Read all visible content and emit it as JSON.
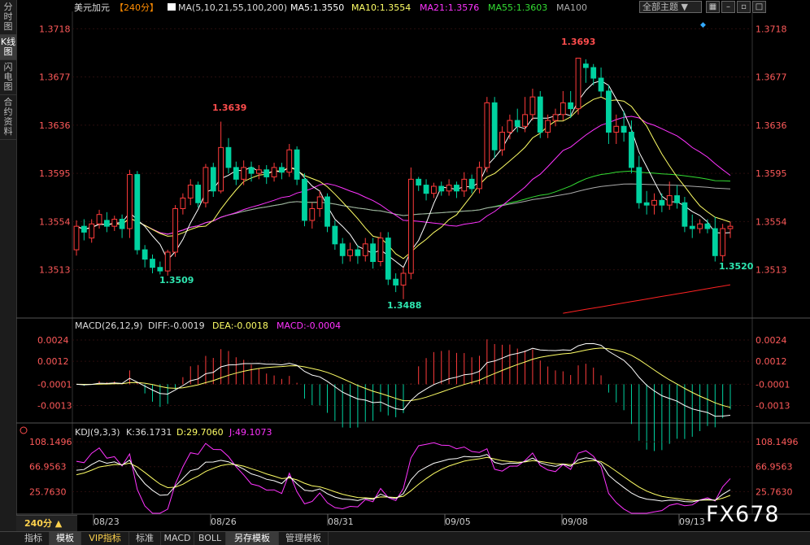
{
  "sidebar": [
    {
      "label": "分时图",
      "active": false
    },
    {
      "label": "K线图",
      "active": true
    },
    {
      "label": "闪电图",
      "active": false
    },
    {
      "label": "合约资料",
      "active": false
    }
  ],
  "header": {
    "symbol": "美元加元",
    "period_tag": "【240分】",
    "ma_params": "MA(5,10,21,55,100,200)",
    "ma5": "MA5:1.3550",
    "ma10": "MA10:1.3554",
    "ma21": "MA21:1.3576",
    "ma55": "MA55:1.3603",
    "ma100": "MA100",
    "theme_button": "全部主题"
  },
  "colors": {
    "up": "#ff3b3b",
    "down": "#00d2a0",
    "ma5": "#ffffff",
    "ma10": "#ffff66",
    "ma21": "#ff33ff",
    "ma55": "#33dd33",
    "ma100": "#aaaaaa",
    "ma200": "#ff2222"
  },
  "price_axis": [
    "1.3718",
    "1.3677",
    "1.3636",
    "1.3595",
    "1.3554",
    "1.3513"
  ],
  "annotations": {
    "high1": "1.3639",
    "high2": "1.3693",
    "low1": "1.3509",
    "low2": "1.3488",
    "low3": "1.3520"
  },
  "macd": {
    "title": "MACD(26,12,9)",
    "diff": "DIFF:-0.0019",
    "dea": "DEA:-0.0018",
    "macd": "MACD:-0.0004",
    "axis": [
      "0.0024",
      "0.0012",
      "-0.0001",
      "-0.0013"
    ]
  },
  "kdj": {
    "title": "KDJ(9,3,3)",
    "k": "K:36.1731",
    "d": "D:29.7060",
    "j": "J:49.1073",
    "axis": [
      "108.1496",
      "66.9563",
      "25.7630"
    ]
  },
  "dates": [
    "08/23",
    "08/26",
    "08/31",
    "09/05",
    "09/08",
    "09/13"
  ],
  "period_button": "240分 ▲",
  "watermark": "FX678",
  "bottom_tabs": [
    "指标",
    "模板",
    "VIP指标",
    "标准",
    "MACD",
    "BOLL",
    "另存模板",
    "管理模板"
  ],
  "chart_data": {
    "type": "candlestick",
    "title": "美元加元 240分",
    "y_range": [
      1.3474,
      1.373
    ],
    "candles": [
      [
        1.353,
        1.355,
        1.3525,
        1.3555
      ],
      [
        1.355,
        1.3545,
        1.3538,
        1.3556
      ],
      [
        1.354,
        1.3552,
        1.3536,
        1.3556
      ],
      [
        1.3552,
        1.356,
        1.3548,
        1.3564
      ],
      [
        1.3555,
        1.355,
        1.3545,
        1.3562
      ],
      [
        1.355,
        1.3556,
        1.3546,
        1.3559
      ],
      [
        1.3556,
        1.3548,
        1.354,
        1.356
      ],
      [
        1.3548,
        1.3594,
        1.354,
        1.3598
      ],
      [
        1.3594,
        1.353,
        1.3526,
        1.3597
      ],
      [
        1.353,
        1.3522,
        1.3515,
        1.3534
      ],
      [
        1.3522,
        1.3515,
        1.351,
        1.3526
      ],
      [
        1.3515,
        1.3512,
        1.3509,
        1.352
      ],
      [
        1.3512,
        1.3528,
        1.3508,
        1.353
      ],
      [
        1.3528,
        1.3565,
        1.3524,
        1.3568
      ],
      [
        1.3565,
        1.3574,
        1.356,
        1.3578
      ],
      [
        1.3574,
        1.3585,
        1.3568,
        1.359
      ],
      [
        1.3585,
        1.357,
        1.3566,
        1.3588
      ],
      [
        1.357,
        1.36,
        1.3566,
        1.3603
      ],
      [
        1.36,
        1.358,
        1.3575,
        1.3604
      ],
      [
        1.358,
        1.3617,
        1.3578,
        1.3639
      ],
      [
        1.3617,
        1.36,
        1.3595,
        1.3625
      ],
      [
        1.36,
        1.359,
        1.3585,
        1.3605
      ],
      [
        1.359,
        1.36,
        1.3585,
        1.3606
      ],
      [
        1.36,
        1.3595,
        1.3588,
        1.3605
      ],
      [
        1.3595,
        1.3598,
        1.359,
        1.3602
      ],
      [
        1.3598,
        1.3592,
        1.3586,
        1.3602
      ],
      [
        1.3592,
        1.36,
        1.3588,
        1.3604
      ],
      [
        1.36,
        1.3596,
        1.359,
        1.3604
      ],
      [
        1.3596,
        1.3615,
        1.3592,
        1.362
      ],
      [
        1.3615,
        1.359,
        1.3585,
        1.3618
      ],
      [
        1.359,
        1.3555,
        1.355,
        1.3595
      ],
      [
        1.3555,
        1.3565,
        1.3548,
        1.357
      ],
      [
        1.3565,
        1.3575,
        1.3558,
        1.358
      ],
      [
        1.3575,
        1.355,
        1.3545,
        1.3578
      ],
      [
        1.355,
        1.3535,
        1.353,
        1.3555
      ],
      [
        1.3535,
        1.3525,
        1.3518,
        1.354
      ],
      [
        1.3525,
        1.353,
        1.352,
        1.3536
      ],
      [
        1.353,
        1.3525,
        1.3518,
        1.3534
      ],
      [
        1.3525,
        1.3535,
        1.352,
        1.354
      ],
      [
        1.3535,
        1.352,
        1.3514,
        1.354
      ],
      [
        1.352,
        1.354,
        1.3516,
        1.3545
      ],
      [
        1.354,
        1.3505,
        1.35,
        1.3545
      ],
      [
        1.3505,
        1.35,
        1.3494,
        1.351
      ],
      [
        1.35,
        1.351,
        1.3488,
        1.3515
      ],
      [
        1.351,
        1.359,
        1.3505,
        1.36
      ],
      [
        1.359,
        1.3585,
        1.358,
        1.3592
      ],
      [
        1.3585,
        1.3578,
        1.3572,
        1.359
      ],
      [
        1.3578,
        1.3584,
        1.3574,
        1.3587
      ],
      [
        1.3584,
        1.358,
        1.3576,
        1.3588
      ],
      [
        1.358,
        1.3585,
        1.3576,
        1.359
      ],
      [
        1.3585,
        1.358,
        1.3574,
        1.3588
      ],
      [
        1.358,
        1.359,
        1.3575,
        1.3596
      ],
      [
        1.359,
        1.3582,
        1.3578,
        1.3594
      ],
      [
        1.3582,
        1.36,
        1.3578,
        1.3605
      ],
      [
        1.36,
        1.3655,
        1.3596,
        1.366
      ],
      [
        1.3655,
        1.3615,
        1.3608,
        1.366
      ],
      [
        1.3615,
        1.363,
        1.361,
        1.3635
      ],
      [
        1.363,
        1.364,
        1.3624,
        1.3645
      ],
      [
        1.364,
        1.3635,
        1.363,
        1.365
      ],
      [
        1.3635,
        1.3645,
        1.363,
        1.366
      ],
      [
        1.3645,
        1.366,
        1.364,
        1.3667
      ],
      [
        1.366,
        1.363,
        1.3625,
        1.3665
      ],
      [
        1.363,
        1.364,
        1.3625,
        1.3645
      ],
      [
        1.364,
        1.3645,
        1.3635,
        1.365
      ],
      [
        1.3645,
        1.3655,
        1.364,
        1.3665
      ],
      [
        1.3655,
        1.365,
        1.3642,
        1.3665
      ],
      [
        1.365,
        1.3693,
        1.3645,
        1.3693
      ],
      [
        1.3688,
        1.3685,
        1.3672,
        1.3692
      ],
      [
        1.3685,
        1.3676,
        1.367,
        1.3688
      ],
      [
        1.3676,
        1.3665,
        1.366,
        1.3685
      ],
      [
        1.3665,
        1.363,
        1.362,
        1.367
      ],
      [
        1.363,
        1.3635,
        1.362,
        1.3645
      ],
      [
        1.3635,
        1.363,
        1.3622,
        1.3648
      ],
      [
        1.363,
        1.36,
        1.3595,
        1.364
      ],
      [
        1.36,
        1.357,
        1.3565,
        1.361
      ],
      [
        1.357,
        1.3568,
        1.356,
        1.358
      ],
      [
        1.3568,
        1.3572,
        1.356,
        1.3578
      ],
      [
        1.3572,
        1.3568,
        1.3562,
        1.3578
      ],
      [
        1.3568,
        1.3576,
        1.3564,
        1.3588
      ],
      [
        1.3576,
        1.357,
        1.3565,
        1.3585
      ],
      [
        1.357,
        1.355,
        1.3545,
        1.3575
      ],
      [
        1.355,
        1.3548,
        1.354,
        1.356
      ],
      [
        1.3548,
        1.3552,
        1.3544,
        1.3556
      ],
      [
        1.3552,
        1.3548,
        1.3544,
        1.3556
      ],
      [
        1.3548,
        1.3525,
        1.352,
        1.3558
      ],
      [
        1.3525,
        1.3548,
        1.352,
        1.3552
      ],
      [
        1.3548,
        1.355,
        1.354,
        1.3554
      ]
    ]
  }
}
